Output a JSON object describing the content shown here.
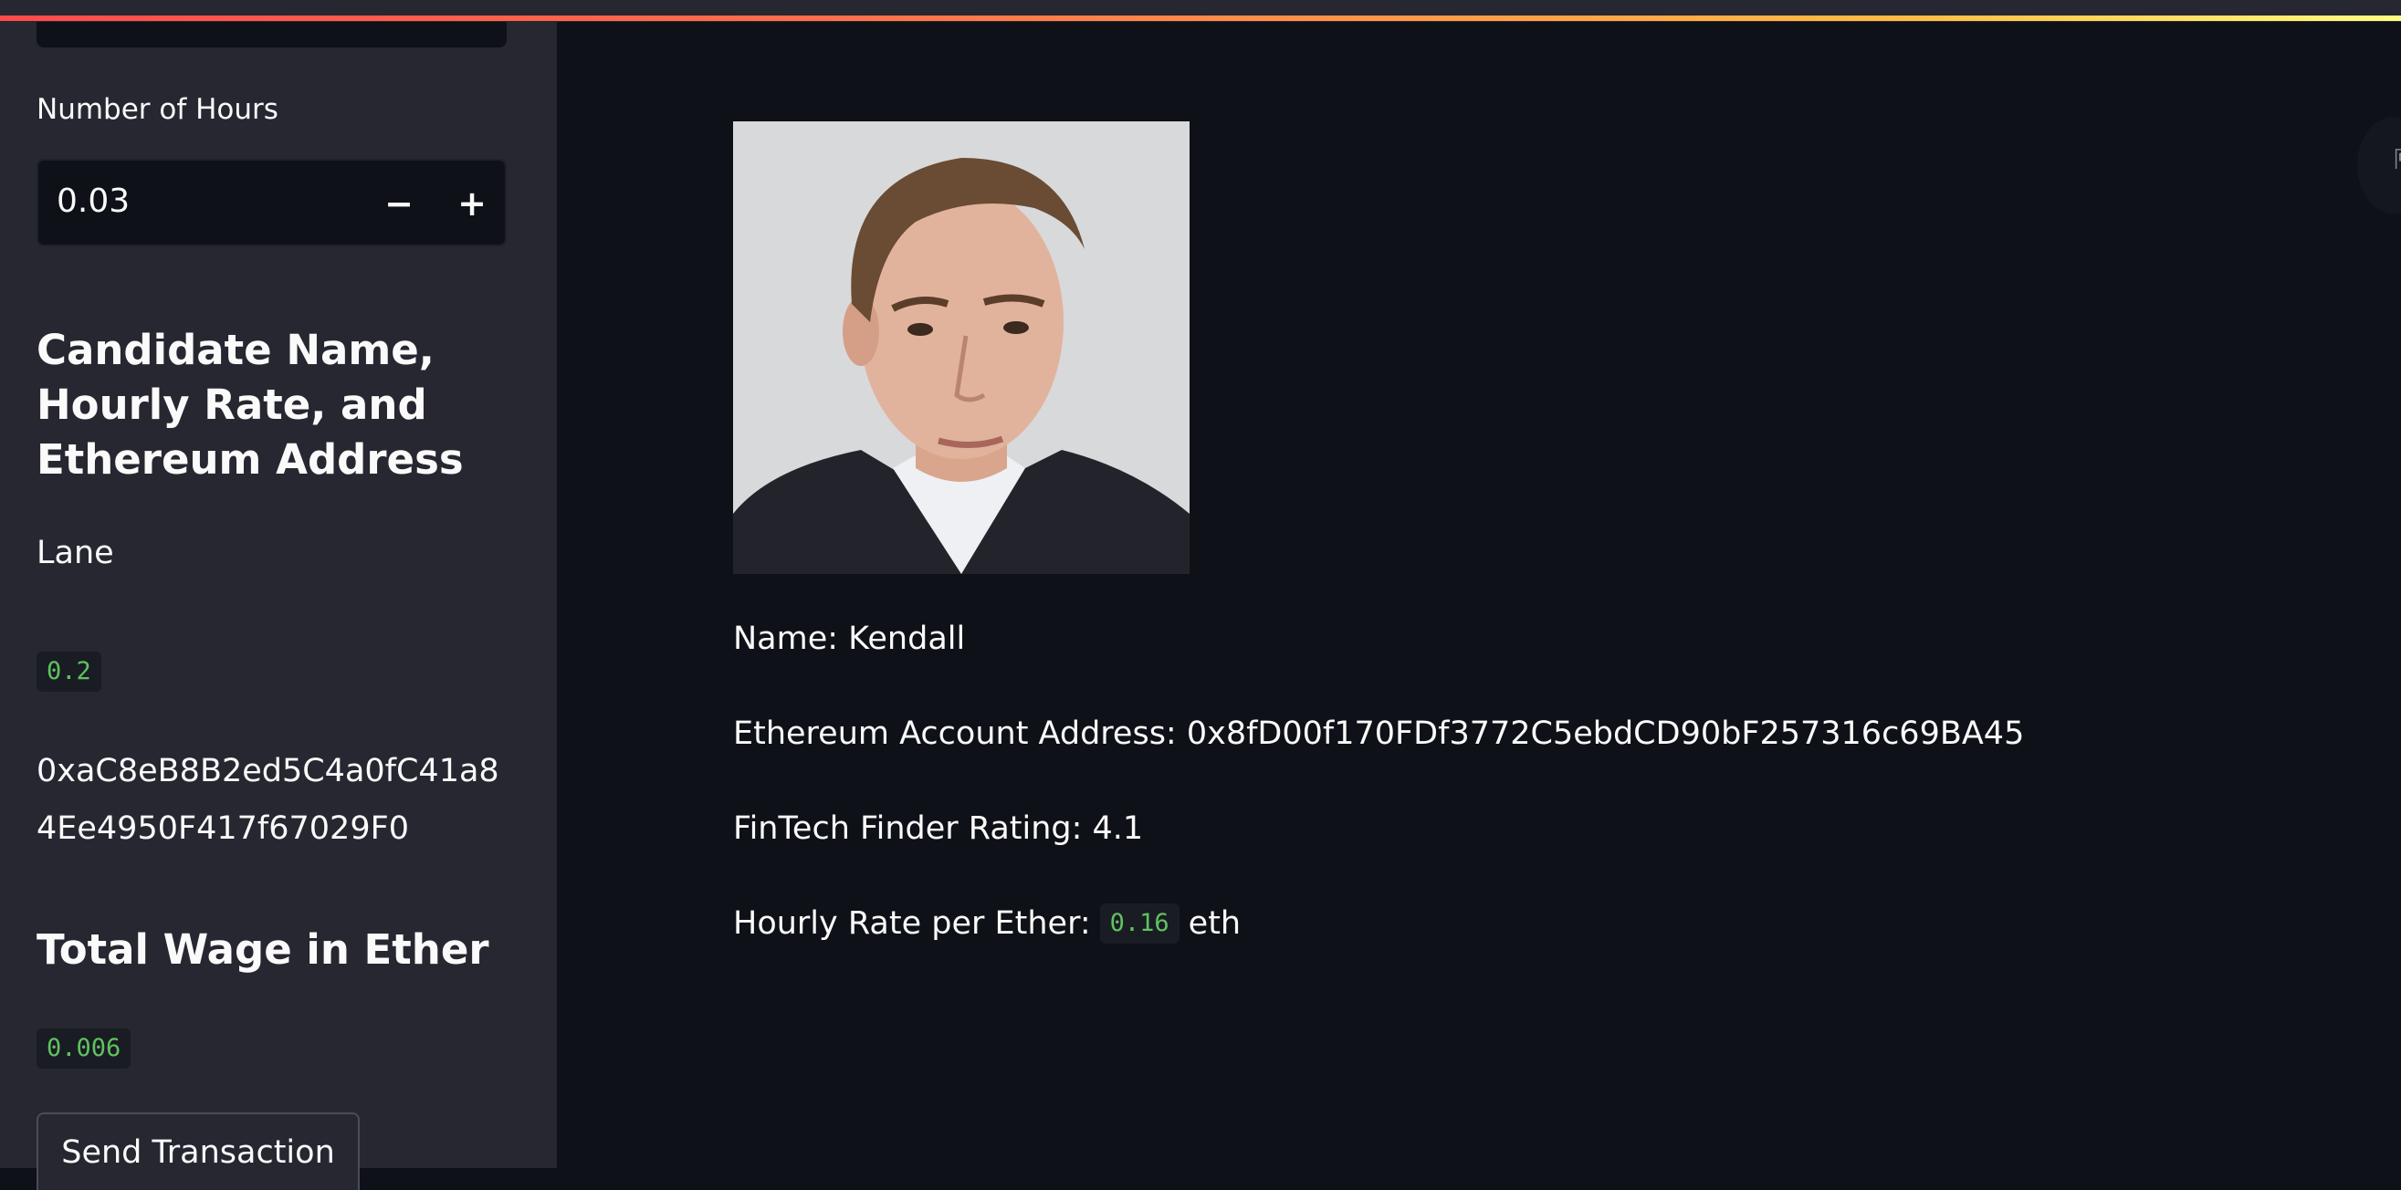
{
  "sidebar": {
    "hours_label": "Number of Hours",
    "hours_value": "0.03",
    "minus_symbol": "−",
    "plus_symbol": "+",
    "candidate_heading": "Candidate Name, Hourly Rate, and Ethereum Address",
    "candidate_name": "Lane",
    "candidate_rate": "0.2",
    "candidate_address": "0xaC8eB8B2ed5C4a0fC41a84Ee4950F417f67029F0",
    "total_heading": "Total Wage in Ether",
    "total_value": "0.006",
    "send_button": "Send Transaction"
  },
  "main": {
    "name_line": "Name: Kendall",
    "address_line": "Ethereum Account Address: 0x8fD00f170FDf3772C5ebdCD90bF257316c69BA45",
    "rating_line": "FinTech Finder Rating: 4.1",
    "rate_label": "Hourly Rate per Ether:",
    "rate_value": "0.16",
    "rate_unit": "eth",
    "collapse_icon": "⇱"
  },
  "colors": {
    "background": "#0e1117",
    "sidebar": "#262730",
    "code_text": "#5fc25f"
  }
}
